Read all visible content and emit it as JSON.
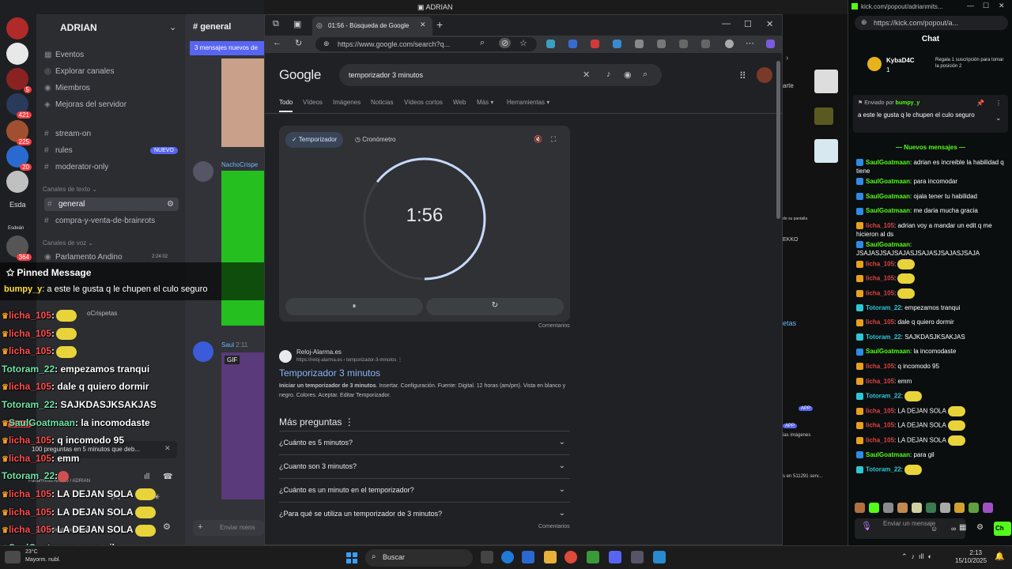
{
  "top_title": "ADRIAN",
  "discord": {
    "server_name": "ADRIAN",
    "guild_badges": [
      "5",
      "421",
      "225",
      "20",
      "364"
    ],
    "guild_labels": [
      "Esda",
      "Esdeán"
    ],
    "items": [
      {
        "icon": "▦",
        "label": "Eventos"
      },
      {
        "icon": "◎",
        "label": "Explorar canales"
      },
      {
        "icon": "◉",
        "label": "Miembros"
      },
      {
        "icon": "◈",
        "label": "Mejoras del servidor"
      }
    ],
    "channels_top": [
      {
        "label": "stream-on"
      },
      {
        "label": "rules",
        "badge": "NUEVO"
      },
      {
        "label": "moderator-only"
      }
    ],
    "cat_text": "Canales de texto ⌄",
    "active_channel": "general",
    "channel_brainrots": "compra-y-venta-de-brainrots",
    "cat_voice": "Canales de voz ⌄",
    "voice_channel": "Parlamento Andino",
    "voice_time": "2:24:02",
    "chat_channel": "general",
    "new_messages": "3 mensajes nuevos de",
    "author_1": "NachoCrispe",
    "author_2": "Saul",
    "author_2_time": "2:11",
    "gif_label": "GIF",
    "crispetas": "oCrispetas",
    "voice_card": "100 preguntas en 5 minutos que deb...",
    "voice_sub": "Parlamento Andino / ADRIAN",
    "voice_share": "Compartiendo su pantalla",
    "nuevo_badge": "NUEVO",
    "composer_placeholder": "Enviar mens"
  },
  "overlay": {
    "pinned_title": "Pinned Message",
    "pinned_user": "bumpy_y",
    "pinned_text": ": a este le gusta q le chupen el culo seguro",
    "lines": [
      {
        "user": "licha_105",
        "text": ":",
        "emote": "yellow"
      },
      {
        "user": "licha_105",
        "text": ":",
        "emote": "yellow"
      },
      {
        "user": "licha_105",
        "text": ":",
        "emote": "yellow"
      },
      {
        "user": "Totoram_22",
        "text": ": empezamos tranqui"
      },
      {
        "user": "licha_105",
        "text": ": dale q quiero dormir"
      },
      {
        "user": "Totoram_22",
        "text": ": SAJKDASJKSAKJAS"
      },
      {
        "user": "SaulGoatmaan",
        "text": ": la incomodaste"
      },
      {
        "user": "licha_105",
        "text": ": q incomodo 95"
      },
      {
        "user": "licha_105",
        "text": ": emm"
      },
      {
        "user": "Totoram_22",
        "text": ":",
        "emote": "red"
      },
      {
        "user": "licha_105",
        "text": ": LA DEJAN SOLA",
        "emote": "yellow"
      },
      {
        "user": "licha_105",
        "text": ": LA DEJAN SOLA",
        "emote": "yellow"
      },
      {
        "user": "licha_105",
        "text": ": LA DEJAN SOLA",
        "emote": "yellow"
      },
      {
        "user": "SaulGoatmaan",
        "text": ": para gil"
      },
      {
        "user": "Totoram_22",
        "text": ":",
        "emote": "orange"
      }
    ]
  },
  "browser": {
    "tab_title": "01:56 - Búsqueda de Google",
    "url": "https://www.google.com/search?q...",
    "google_logo": "Google",
    "query": "temporizador 3 minutos",
    "tabs": [
      "Todo",
      "Vídeos",
      "Imágenes",
      "Noticias",
      "Vídeos cortos",
      "Web",
      "Más ▾",
      "Herramientas ▾"
    ],
    "timer": {
      "mode_timer": "✓ Temporizador",
      "mode_stopwatch": "◷ Cronómetro",
      "display": "1:56",
      "remaining_fraction": 0.644,
      "pause_icon": "⏸",
      "reset_icon": "↻"
    },
    "feedback": "Comentarios",
    "result": {
      "site": "Reloj-Alarma.es",
      "url": "https://reloj-alarma.es › temporizador-3-minutos  ⋮",
      "title": "Temporizador 3 minutos",
      "snippet_bold": "Iniciar un temporizador de 3 minutos",
      "snippet": ". Insertar. Configuración. Fuente: Digital. 12 horas (am/pm). Vista en blanco y negro. Colores. Aceptar. Editar Temporizador."
    },
    "mas_preguntas": "Más preguntas  ⋮",
    "questions": [
      "¿Cuánto es 5 minutos?",
      "¿Cuanto son 3 minutos?",
      "¿Cuánto es un minuto en el temporizador?",
      "¿Para qué se utiliza un temporizador de 3 minutos?"
    ]
  },
  "mid_strip": {
    "labels": [
      "arte",
      "EKKO",
      "do su pantalla",
      "etas",
      "APP",
      "APP",
      "ias imágenes",
      "s en 511291 serv..."
    ]
  },
  "kick": {
    "window_title": "kick.com/popout/adrianmits...",
    "url": "https://kick.com/popout/a...",
    "chat_header": "Chat",
    "sub_name": "KybaD4C",
    "sub_count": "1",
    "sub_text": "Regala 1 suscripción para tomar la posición 2",
    "pinned_by_label": "Enviado por",
    "pinned_by_user": "bumpy_y",
    "pinned_msg": "a este le gusta q le chupen el culo seguro",
    "new_messages": "— Nuevos mensajes —",
    "messages": [
      {
        "user": "SaulGoatmaan",
        "color": "green",
        "text": ": adrian es increible la habilidad q tiene"
      },
      {
        "user": "SaulGoatmaan",
        "color": "green",
        "text": ": para incomodar"
      },
      {
        "user": "SaulGoatmaan",
        "color": "green",
        "text": ": ojala tener tu habilidad"
      },
      {
        "user": "SaulGoatmaan",
        "color": "green",
        "text": ": me daria mucha gracia"
      },
      {
        "user": "licha_105",
        "color": "red",
        "text": ": adrian voy a mandar un edit q me hicieron al ds"
      },
      {
        "user": "SaulGoatmaan",
        "color": "green",
        "text": ": JSAJASJSAJSAJASJSAJASJSAJASJSAJA"
      },
      {
        "user": "licha_105",
        "color": "red",
        "text": ":",
        "emote": true
      },
      {
        "user": "licha_105",
        "color": "red",
        "text": ":",
        "emote": true
      },
      {
        "user": "licha_105",
        "color": "red",
        "text": ":",
        "emote": true
      },
      {
        "user": "Totoram_22",
        "color": "cyan",
        "text": ": empezamos tranqui"
      },
      {
        "user": "licha_105",
        "color": "red",
        "text": ": dale q quiero dormir"
      },
      {
        "user": "Totoram_22",
        "color": "cyan",
        "text": ": SAJKDASJKSAKJAS"
      },
      {
        "user": "SaulGoatmaan",
        "color": "green",
        "text": ": la incomodaste"
      },
      {
        "user": "licha_105",
        "color": "red",
        "text": ": q incomodo 95"
      },
      {
        "user": "licha_105",
        "color": "red",
        "text": ": emm"
      },
      {
        "user": "Totoram_22",
        "color": "cyan",
        "text": ":",
        "emote": true
      },
      {
        "user": "licha_105",
        "color": "red",
        "text": ": LA DEJAN SOLA",
        "emote": true
      },
      {
        "user": "licha_105",
        "color": "red",
        "text": ": LA DEJAN SOLA",
        "emote": true
      },
      {
        "user": "licha_105",
        "color": "red",
        "text": ": LA DEJAN SOLA",
        "emote": true
      },
      {
        "user": "SaulGoatmaan",
        "color": "green",
        "text": ": para gil"
      },
      {
        "user": "Totoram_22",
        "color": "cyan",
        "text": ":",
        "emote": true
      }
    ],
    "input_placeholder": "Enviar un mensaje",
    "send_label": "Ch"
  },
  "taskbar": {
    "weather_temp": "23°C",
    "weather_desc": "Mayorm. nubl.",
    "search_label": "Buscar",
    "time": "2:13",
    "date": "15/10/2025"
  },
  "colors": {
    "kick_green": "#53fc18",
    "discord_blurple": "#5865f2",
    "google_link": "#8ab4f8"
  }
}
